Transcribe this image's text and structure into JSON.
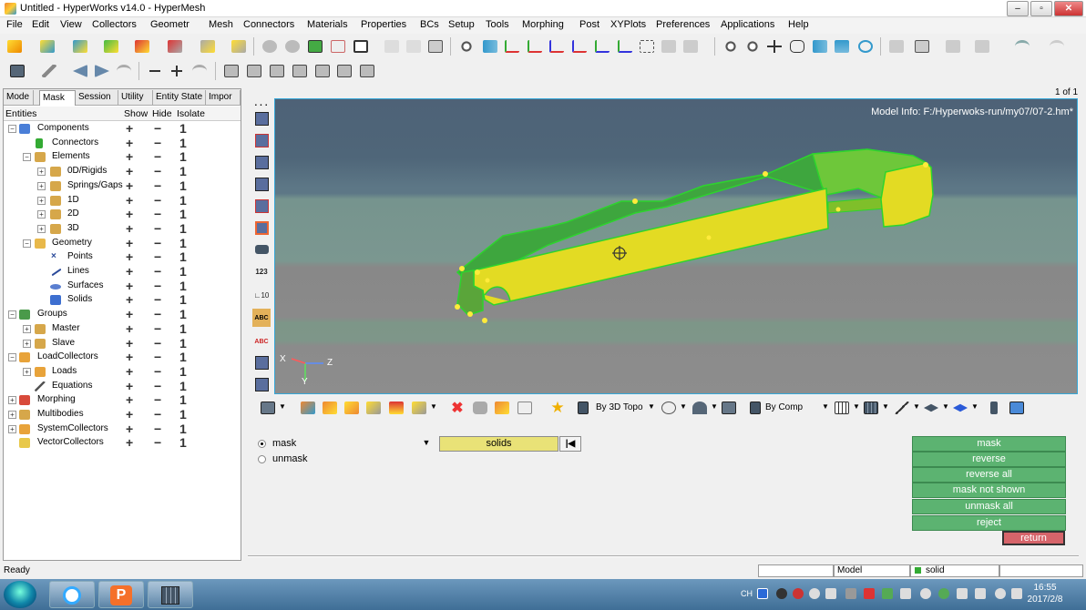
{
  "window": {
    "title": "Untitled - HyperWorks v14.0 - HyperMesh",
    "min": "–",
    "max": "▫",
    "close": "✕"
  },
  "menu": [
    "File",
    "Edit",
    "View",
    "Collectors",
    "Geometr",
    "Mesh",
    "Connectors",
    "Materials",
    "Properties",
    "BCs",
    "Setup",
    "Tools",
    "Morphing",
    "Post",
    "XYPlots",
    "Preferences",
    "Applications",
    "Help"
  ],
  "tabs": [
    "Mode",
    "Mask",
    "Session",
    "Utility",
    "Entity State",
    "Impor"
  ],
  "columns": {
    "entities": "Entities",
    "show": "Show",
    "hide": "Hide",
    "isolate": "Isolate"
  },
  "tree": [
    {
      "label": "Components",
      "icon": "components-icon"
    },
    {
      "label": "Connectors",
      "icon": "connectors-icon"
    },
    {
      "label": "Elements",
      "icon": "elements-icon"
    },
    {
      "label": "0D/Rigids",
      "icon": "element-type-icon"
    },
    {
      "label": "Springs/Gaps",
      "icon": "element-type-icon"
    },
    {
      "label": "1D",
      "icon": "element-type-icon"
    },
    {
      "label": "2D",
      "icon": "element-type-icon"
    },
    {
      "label": "3D",
      "icon": "element-type-icon"
    },
    {
      "label": "Geometry",
      "icon": "geometry-icon"
    },
    {
      "label": "Points",
      "icon": "points-icon"
    },
    {
      "label": "Lines",
      "icon": "lines-icon"
    },
    {
      "label": "Surfaces",
      "icon": "surfaces-icon"
    },
    {
      "label": "Solids",
      "icon": "solids-icon"
    },
    {
      "label": "Groups",
      "icon": "groups-icon"
    },
    {
      "label": "Master",
      "icon": "group-icon"
    },
    {
      "label": "Slave",
      "icon": "group-icon"
    },
    {
      "label": "LoadCollectors",
      "icon": "loadcollectors-icon"
    },
    {
      "label": "Loads",
      "icon": "loads-icon"
    },
    {
      "label": "Equations",
      "icon": "equations-icon"
    },
    {
      "label": "Morphing",
      "icon": "morphing-icon"
    },
    {
      "label": "Multibodies",
      "icon": "multibodies-icon"
    },
    {
      "label": "SystemCollectors",
      "icon": "systemcollectors-icon"
    },
    {
      "label": "VectorCollectors",
      "icon": "vectorcollectors-icon"
    }
  ],
  "row_actions": {
    "show": "+",
    "hide": "−",
    "isolate": "1"
  },
  "viewport": {
    "page": "1 of 1",
    "model_info": "Model Info: F:/Hyperwoks-run/my07/07-2.hm*",
    "axis_x": "X",
    "axis_y": "Y",
    "axis_z": "Z"
  },
  "bottom_toolbar": {
    "topo": "By 3D Topo",
    "comp": "By Comp"
  },
  "panel": {
    "radio_mask": "mask",
    "radio_unmask": "unmask",
    "selector": "solids",
    "buttons": [
      "mask",
      "reverse",
      "reverse all",
      "mask not shown",
      "unmask all",
      "reject"
    ],
    "return": "return"
  },
  "status": {
    "ready": "Ready",
    "model": "Model",
    "solid": "solid"
  },
  "taskbar": {
    "lang": "CH",
    "time": "16:55",
    "date": "2017/2/8"
  }
}
